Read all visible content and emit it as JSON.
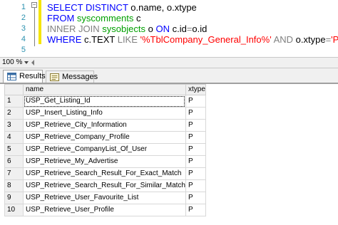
{
  "editor": {
    "line_numbers": [
      "1",
      "2",
      "3",
      "4",
      "5"
    ],
    "lines": [
      [
        {
          "t": "SELECT DISTINCT ",
          "c": "kw"
        },
        {
          "t": "o.name, o.xtype",
          "c": "blk"
        }
      ],
      [
        {
          "t": "FROM ",
          "c": "kw"
        },
        {
          "t": "syscomments ",
          "c": "sys"
        },
        {
          "t": "c",
          "c": "blk"
        }
      ],
      [
        {
          "t": "INNER JOIN ",
          "c": "gray"
        },
        {
          "t": "sysobjects ",
          "c": "sys"
        },
        {
          "t": "o ",
          "c": "blk"
        },
        {
          "t": "ON ",
          "c": "kw"
        },
        {
          "t": "c.id",
          "c": "blk"
        },
        {
          "t": "=",
          "c": "gray"
        },
        {
          "t": "o.id",
          "c": "blk"
        }
      ],
      [
        {
          "t": "WHERE ",
          "c": "kw"
        },
        {
          "t": "c.TEXT ",
          "c": "blk"
        },
        {
          "t": "LIKE ",
          "c": "gray"
        },
        {
          "t": "'%TblCompany_General_Info%' ",
          "c": "str"
        },
        {
          "t": "AND ",
          "c": "gray"
        },
        {
          "t": "o.xtype",
          "c": "blk"
        },
        {
          "t": "=",
          "c": "gray"
        },
        {
          "t": "'P'",
          "c": "str"
        }
      ],
      []
    ]
  },
  "zoom": {
    "value": "100 %"
  },
  "tabs": {
    "results": "Results",
    "messages": "Messages"
  },
  "grid": {
    "headers": {
      "name": "name",
      "xtype": "xtype"
    },
    "rows": [
      {
        "n": "1",
        "name": "USP_Get_Listing_Id",
        "xtype": "P"
      },
      {
        "n": "2",
        "name": "USP_Insert_Listing_Info",
        "xtype": "P"
      },
      {
        "n": "3",
        "name": "USP_Retrieve_City_Information",
        "xtype": "P"
      },
      {
        "n": "4",
        "name": "USP_Retrieve_Company_Profile",
        "xtype": "P"
      },
      {
        "n": "5",
        "name": "USP_Retrieve_CompanyList_Of_User",
        "xtype": "P"
      },
      {
        "n": "6",
        "name": "USP_Retrieve_My_Advertise",
        "xtype": "P"
      },
      {
        "n": "7",
        "name": "USP_Retrieve_Search_Result_For_Exact_Match",
        "xtype": "P"
      },
      {
        "n": "8",
        "name": "USP_Retrieve_Search_Result_For_Similar_Match",
        "xtype": "P"
      },
      {
        "n": "9",
        "name": "USP_Retrieve_User_Favourite_List",
        "xtype": "P"
      },
      {
        "n": "10",
        "name": "USP_Retrieve_User_Profile",
        "xtype": "P"
      }
    ]
  }
}
